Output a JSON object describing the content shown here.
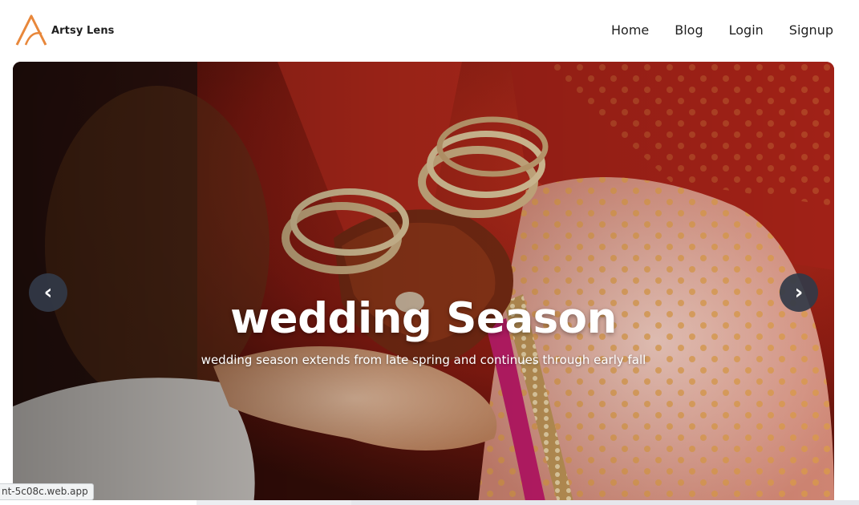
{
  "brand": {
    "name": "Artsy Lens",
    "logo_color": "#e8873a"
  },
  "nav": {
    "items": [
      "Home",
      "Blog",
      "Login",
      "Signup"
    ]
  },
  "carousel": {
    "title": "wedding Season",
    "subtitle": "wedding season extends from late spring and continues through early fall",
    "prev_icon": "chevron-left",
    "next_icon": "chevron-right",
    "prev_symbol": "‹",
    "next_symbol": "›"
  },
  "status_bar": {
    "url": "nt-5c08c.web.app"
  },
  "colors": {
    "text_dark": "#1f1f1f",
    "arrow_bg": "#323a48",
    "hero_red": "#b8261a"
  }
}
